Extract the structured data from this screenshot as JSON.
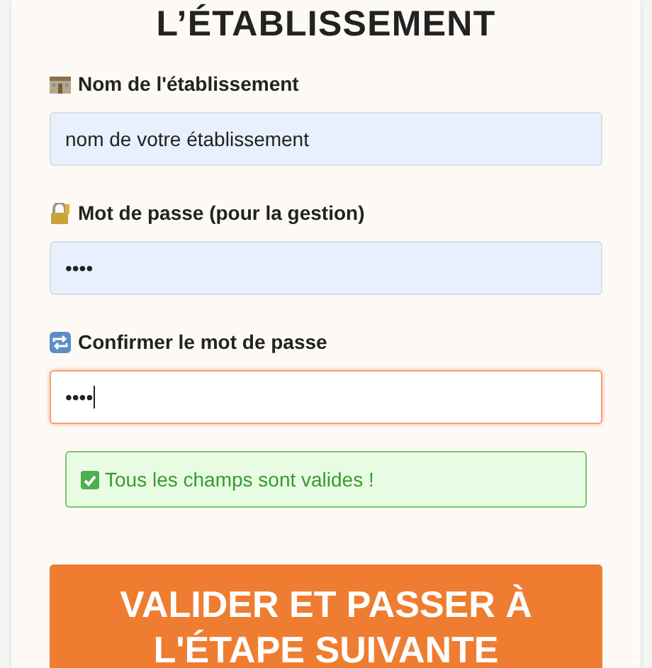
{
  "title": "L’ÉTABLISSEMENT",
  "fields": [
    {
      "label": "Nom de l'établissement",
      "value": "nom de votre établissement",
      "focused": false
    },
    {
      "label": "Mot de passe (pour la gestion)",
      "value": "••••",
      "focused": false
    },
    {
      "label": "Confirmer le mot de passe",
      "value": "••••",
      "focused": true
    }
  ],
  "status": {
    "text": "Tous les champs sont valides !",
    "valid": true
  },
  "submit_button": "VALIDER ET PASSER À L'ÉTAPE SUIVANTE"
}
